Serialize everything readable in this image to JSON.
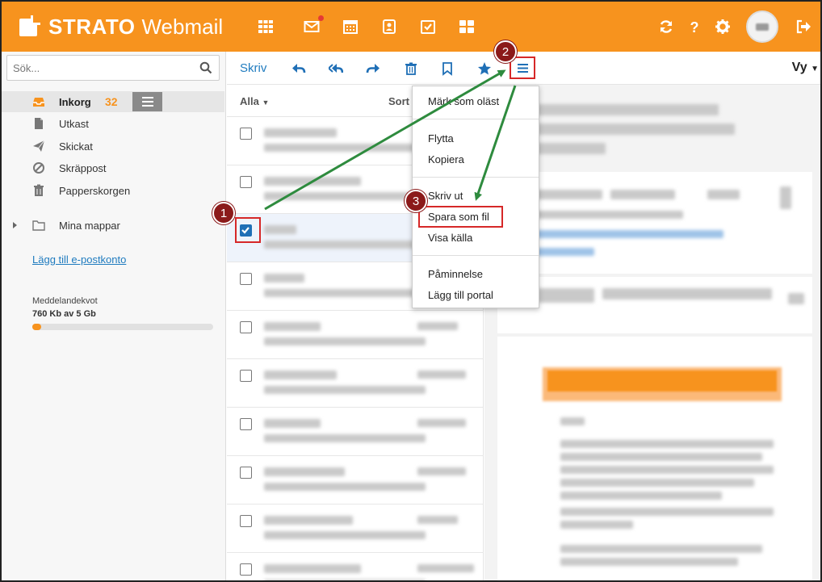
{
  "app": {
    "brand": "STRATO",
    "product": "Webmail"
  },
  "topbar": {
    "icons": [
      "apps-icon",
      "mail-icon",
      "calendar-icon",
      "contacts-icon",
      "tasks-icon",
      "portal-icon"
    ],
    "right_icons": [
      "refresh-icon",
      "help-icon",
      "settings-icon",
      "logout-icon"
    ]
  },
  "sidebar": {
    "search_placeholder": "Sök...",
    "folders": [
      {
        "label": "Inkorg",
        "count": "32",
        "icon": "inbox-icon"
      },
      {
        "label": "Utkast",
        "icon": "draft-icon"
      },
      {
        "label": "Skickat",
        "icon": "sent-icon"
      },
      {
        "label": "Skräppost",
        "icon": "spam-icon"
      },
      {
        "label": "Papperskorgen",
        "icon": "trash-icon"
      }
    ],
    "my_folders": "Mina mappar",
    "add_account": "Lägg till e-postkonto",
    "quota_label": "Meddelandekvot",
    "quota_value": "760 Kb av 5 Gb",
    "quota_fraction": 0.05
  },
  "toolbar": {
    "compose": "Skriv",
    "view": "Vy"
  },
  "list": {
    "filter": "Alla",
    "sort": "Sort"
  },
  "menu": {
    "items": [
      "Märk som oläst",
      "Flytta",
      "Kopiera",
      "Skriv ut",
      "Spara som fil",
      "Visa källa",
      "Påminnelse",
      "Lägg till portal"
    ]
  },
  "callouts": [
    "1",
    "2",
    "3"
  ],
  "colors": {
    "brand": "#f7931e",
    "link": "#1f7bbf",
    "annotation": "#d62828",
    "arrow": "#2e8b3e",
    "callout": "#8b1a1a"
  }
}
